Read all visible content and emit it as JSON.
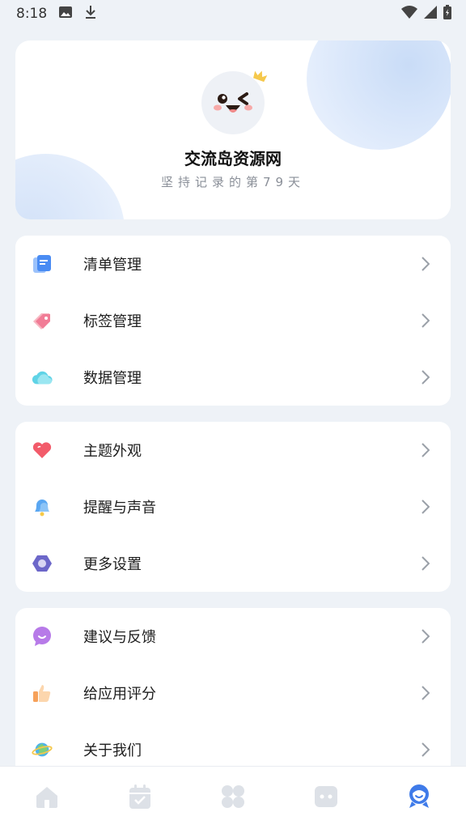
{
  "status_bar": {
    "time": "8:18",
    "icons": [
      "image-icon",
      "download-icon",
      "wifi-icon",
      "signal-icon",
      "battery-icon"
    ]
  },
  "profile": {
    "name": "交流岛资源网",
    "subtitle": "坚持记录的第79天"
  },
  "menu_groups": [
    {
      "items": [
        {
          "label": "清单管理",
          "icon": "list-document-icon"
        },
        {
          "label": "标签管理",
          "icon": "tag-icon"
        },
        {
          "label": "数据管理",
          "icon": "cloud-icon"
        }
      ]
    },
    {
      "items": [
        {
          "label": "主题外观",
          "icon": "heart-icon"
        },
        {
          "label": "提醒与声音",
          "icon": "bell-icon"
        },
        {
          "label": "更多设置",
          "icon": "hexagon-settings-icon"
        }
      ]
    },
    {
      "items": [
        {
          "label": "建议与反馈",
          "icon": "chat-bubble-icon"
        },
        {
          "label": "给应用评分",
          "icon": "thumbs-up-icon"
        },
        {
          "label": "关于我们",
          "icon": "planet-icon"
        }
      ]
    }
  ],
  "bottom_nav": [
    {
      "icon": "home-icon",
      "active": false
    },
    {
      "icon": "calendar-check-icon",
      "active": false
    },
    {
      "icon": "grid-four-icon",
      "active": false
    },
    {
      "icon": "game-controller-icon",
      "active": false
    },
    {
      "icon": "profile-icon",
      "active": true
    }
  ],
  "colors": {
    "background": "#eef2f7",
    "card": "#ffffff",
    "nav_active": "#3f7be9",
    "nav_inactive": "#dde1e7"
  }
}
